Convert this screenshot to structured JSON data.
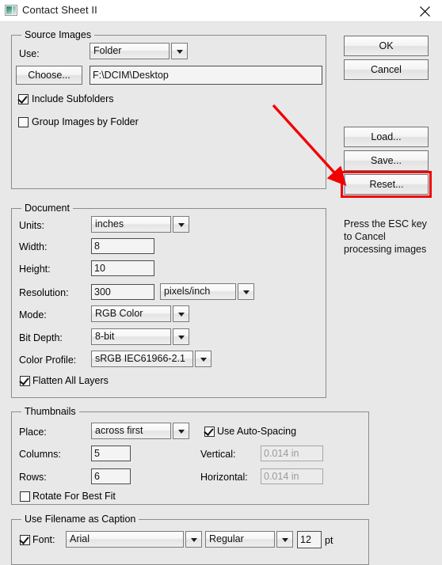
{
  "window": {
    "title": "Contact Sheet II",
    "icon": "contact-sheet-icon",
    "close_icon": "close-icon"
  },
  "source_images": {
    "group_title": "Source Images",
    "use_label": "Use:",
    "use_value": "Folder",
    "choose_label": "Choose...",
    "path_value": "F:\\DCIM\\Desktop",
    "include_subfolders_label": "Include Subfolders",
    "include_subfolders_checked": true,
    "group_images_label": "Group Images by Folder",
    "group_images_checked": false
  },
  "document": {
    "group_title": "Document",
    "units_label": "Units:",
    "units_value": "inches",
    "width_label": "Width:",
    "width_value": "8",
    "height_label": "Height:",
    "height_value": "10",
    "resolution_label": "Resolution:",
    "resolution_value": "300",
    "resolution_units_value": "pixels/inch",
    "mode_label": "Mode:",
    "mode_value": "RGB Color",
    "bit_depth_label": "Bit Depth:",
    "bit_depth_value": "8-bit",
    "color_profile_label": "Color Profile:",
    "color_profile_value": "sRGB IEC61966-2.1",
    "flatten_label": "Flatten All Layers",
    "flatten_checked": true
  },
  "thumbnails": {
    "group_title": "Thumbnails",
    "place_label": "Place:",
    "place_value": "across first",
    "columns_label": "Columns:",
    "columns_value": "5",
    "rows_label": "Rows:",
    "rows_value": "6",
    "auto_spacing_label": "Use Auto-Spacing",
    "auto_spacing_checked": true,
    "vertical_label": "Vertical:",
    "vertical_value": "0.014 in",
    "horizontal_label": "Horizontal:",
    "horizontal_value": "0.014 in",
    "rotate_label": "Rotate For Best Fit",
    "rotate_checked": false
  },
  "caption": {
    "group_title": "Use Filename as Caption",
    "font_label": "Font:",
    "font_checked": true,
    "font_value": "Arial",
    "style_value": "Regular",
    "size_value": "12",
    "size_units": "pt"
  },
  "buttons": {
    "ok": "OK",
    "cancel": "Cancel",
    "load": "Load...",
    "save": "Save...",
    "reset": "Reset..."
  },
  "side_note": "Press the ESC key to Cancel processing images",
  "annotation": {
    "highlight_color": "#f20000",
    "target": "reset-button"
  }
}
